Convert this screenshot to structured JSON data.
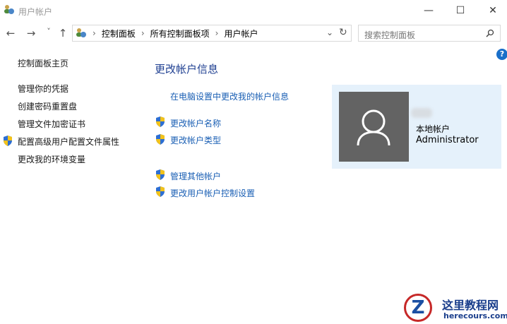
{
  "window": {
    "title": "用户帐户",
    "minimize": "—",
    "maximize": "☐",
    "close": "✕"
  },
  "nav": {
    "back": "←",
    "forward": "→",
    "recent": "˅",
    "up": "↑",
    "dropdown": "⌄",
    "refresh": "↻"
  },
  "breadcrumb": [
    "控制面板",
    "所有控制面板项",
    "用户帐户"
  ],
  "breadcrumb_sep": "›",
  "search": {
    "placeholder": "搜索控制面板"
  },
  "help": "?",
  "sidebar": {
    "home": "控制面板主页",
    "items": [
      "管理你的凭据",
      "创建密码重置盘",
      "管理文件加密证书",
      "配置高级用户配置文件属性",
      "更改我的环境变量"
    ]
  },
  "main": {
    "heading": "更改帐户信息",
    "pc_settings_link": "在电脑设置中更改我的帐户信息",
    "actions": [
      "更改帐户名称",
      "更改帐户类型"
    ],
    "other_actions": [
      "管理其他帐户",
      "更改用户帐户控制设置"
    ]
  },
  "account": {
    "type": "本地帐户",
    "name": "Administrator"
  },
  "watermark": {
    "title": "这里教程网",
    "url": "herecours.com"
  }
}
